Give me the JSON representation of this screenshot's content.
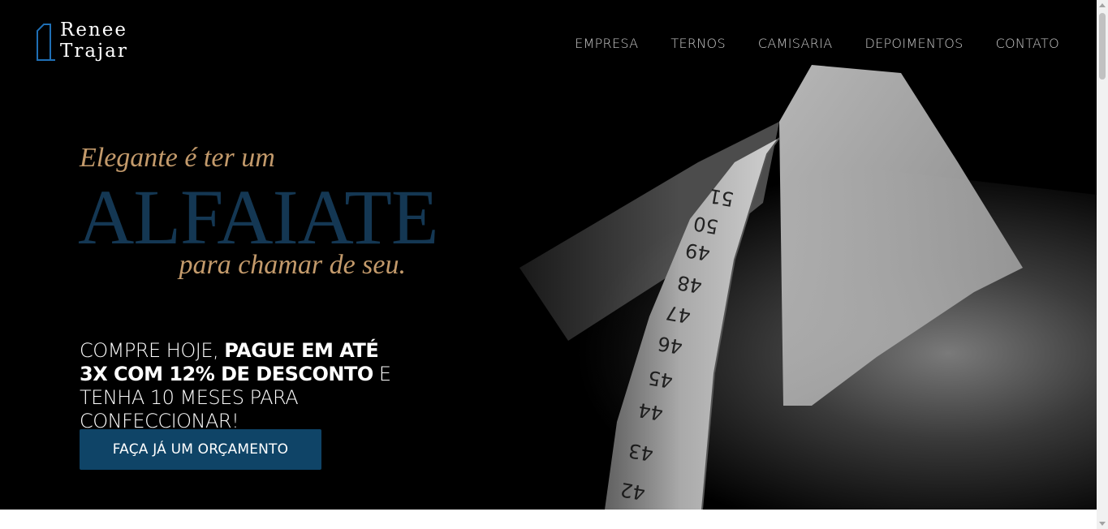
{
  "brand": {
    "name_line1": "Renee",
    "name_line2": "Trajar",
    "icon": "building-outline-icon"
  },
  "nav": {
    "items": [
      {
        "label": "EMPRESA"
      },
      {
        "label": "TERNOS"
      },
      {
        "label": "CAMISARIA"
      },
      {
        "label": "DEPOIMENTOS"
      },
      {
        "label": "CONTATO"
      }
    ]
  },
  "hero": {
    "tagline_top": "Elegante é ter um",
    "headline": "ALFAIATE",
    "tagline_bottom": "para chamar de seu.",
    "promo": {
      "part1": "COMPRE HOJE, ",
      "bold1": "PAGUE EM ATÉ 3X COM 12% DE DESCONTO",
      "part2": " E TENHA 10 MESES PARA CONFECCIONAR!"
    },
    "cta_label": "FAÇA JÁ UM ORÇAMENTO",
    "tape_numbers": [
      "51",
      "50",
      "49",
      "48",
      "47",
      "46",
      "45",
      "44",
      "43",
      "42"
    ]
  },
  "colors": {
    "accent_gold": "#c39a6b",
    "accent_navy": "#143753",
    "button_blue": "#0f4467",
    "logo_blue": "#1f6fb5"
  }
}
